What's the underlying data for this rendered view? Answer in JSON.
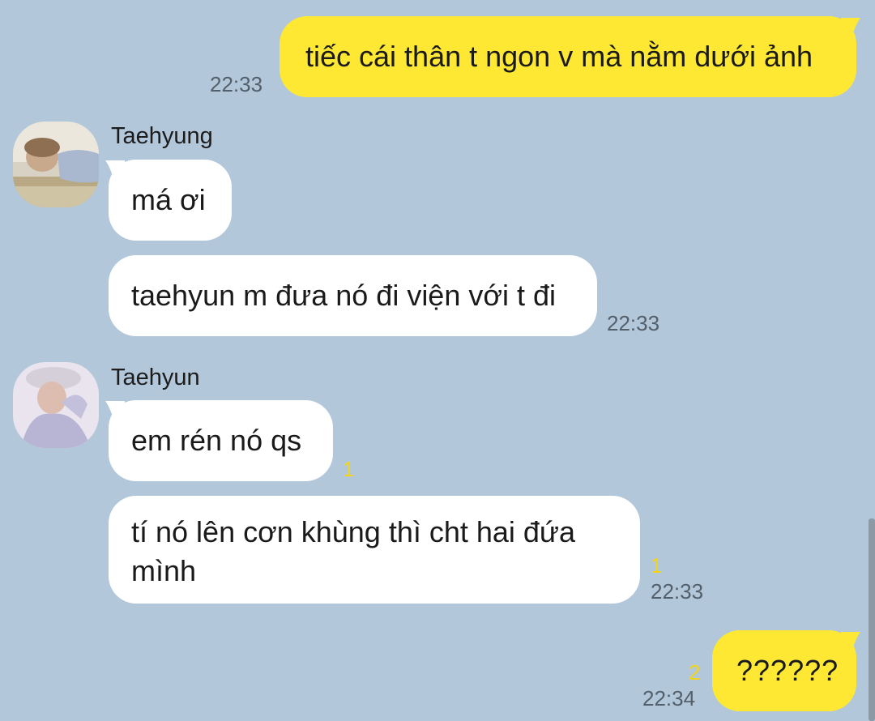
{
  "colors": {
    "background": "#b2c7da",
    "outgoing_bubble": "#fee833",
    "incoming_bubble": "#ffffff",
    "timestamp": "#53606b",
    "unread_count": "#f2d51b"
  },
  "messages": {
    "m1": {
      "text": "tiếc cái thân t ngon v mà nằm dưới ảnh",
      "time": "22:33"
    },
    "g1": {
      "sender": "Taehyung",
      "avatar_icon": "taehyung-avatar"
    },
    "m2": {
      "text": "má ơi"
    },
    "m3": {
      "text": "taehyun m đưa nó đi viện với t đi",
      "time": "22:33"
    },
    "g2": {
      "sender": "Taehyun",
      "avatar_icon": "taehyun-avatar"
    },
    "m4": {
      "text": "em rén nó qs",
      "unread": "1"
    },
    "m5": {
      "line1": "tí nó lên cơn khùng thì cht hai đứa",
      "line2": "mình",
      "unread": "1",
      "time": "22:33"
    },
    "m6": {
      "text": "??????",
      "unread": "2",
      "time": "22:34"
    }
  }
}
